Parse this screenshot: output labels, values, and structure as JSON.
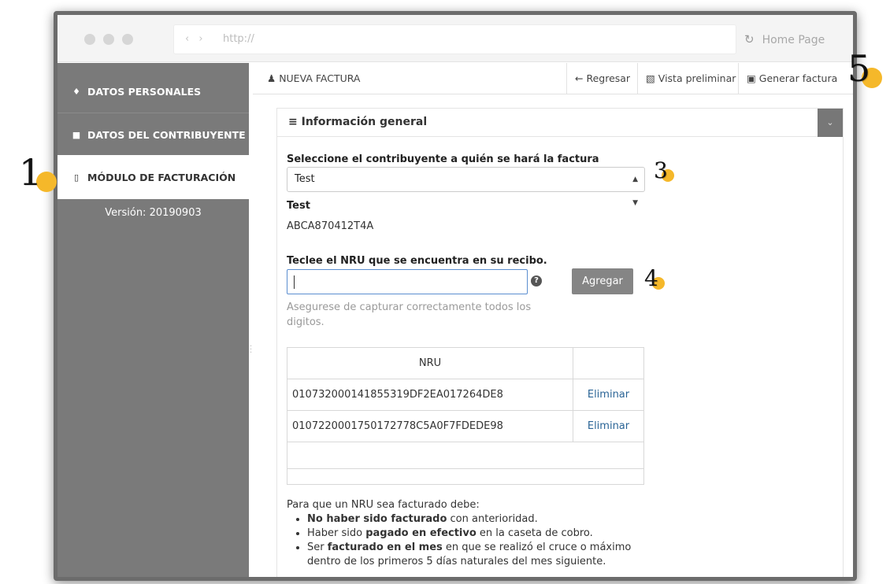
{
  "browser": {
    "url_placeholder": "http://",
    "nav_arrows": "‹ ›",
    "home_label": "Home Page",
    "reload_icon": "↻"
  },
  "sidebar": {
    "items": [
      {
        "label": "DATOS PERSONALES",
        "icon": "person-icon"
      },
      {
        "label": "DATOS DEL CONTRIBUYENTE",
        "icon": "users-icon"
      },
      {
        "label": "MÓDULO DE FACTURACIÓN",
        "icon": "file-icon",
        "active": true
      }
    ],
    "version": "Versión: 20190903"
  },
  "topbar": {
    "title": "NUEVA FACTURA",
    "back_label": "Regresar",
    "preview_label": "Vista preliminar",
    "generate_label": "Generar factura"
  },
  "panel": {
    "title": "Información general",
    "select_label": "Seleccione el contribuyente a quién se hará la factura",
    "select_value": "Test",
    "contrib_name": "Test",
    "contrib_rfc": "ABCA870412T4A",
    "nru_label": "Teclee el NRU que se encuentra en su recibo.",
    "nru_value": "",
    "add_button": "Agregar",
    "hint": "Asegurese de capturar correctamente todos los digitos."
  },
  "table": {
    "header": "NRU",
    "rows": [
      {
        "nru": "010732000141855319DF2EA017264DE8",
        "action": "Eliminar"
      },
      {
        "nru": "0107220001750172778C5A0F7FDEDE98",
        "action": "Eliminar"
      }
    ]
  },
  "rules": {
    "intro": "Para que un NRU sea facturado debe:",
    "r1_bold": "No haber sido facturado",
    "r1_rest": " con anterioridad.",
    "r2_pre": "Haber sido ",
    "r2_bold": "pagado en efectivo",
    "r2_rest": " en la caseta de cobro.",
    "r3_pre": "Ser ",
    "r3_bold": "facturado en el mes",
    "r3_rest": " en que se realizó el cruce o máximo dentro de los primeros 5 días naturales del mes siguiente."
  },
  "markers": [
    "1",
    "3",
    "4",
    "5"
  ],
  "colors": {
    "sidebar": "#7a7a7a",
    "marker": "#f5b82a",
    "link": "#2a6496",
    "button": "#858585"
  }
}
